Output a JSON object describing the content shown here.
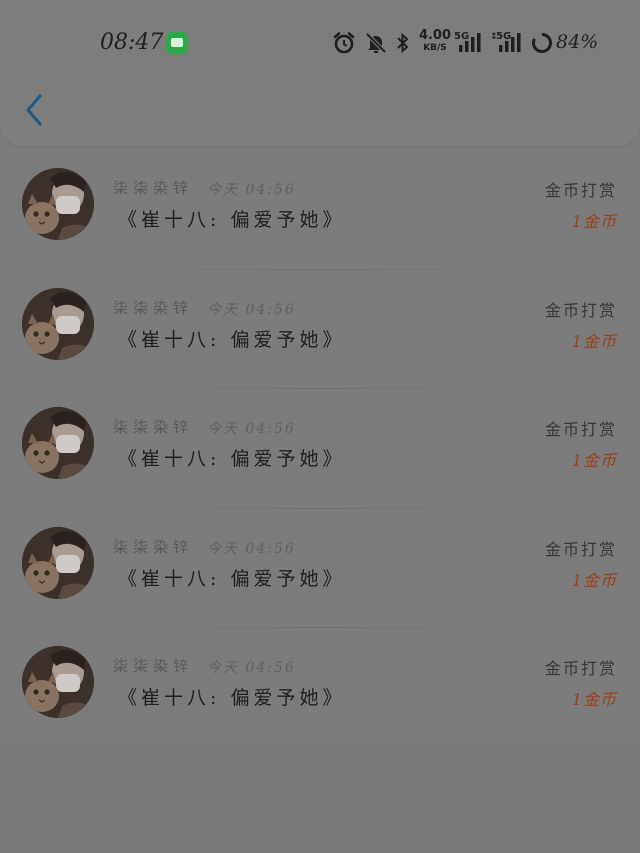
{
  "status_bar": {
    "time": "08:47",
    "net_speed_value": "4.00",
    "net_speed_unit": "KB/S",
    "signal_1": "5G",
    "signal_2": "5G",
    "battery": "84%",
    "icons": [
      "message-app-icon",
      "alarm-icon",
      "mute-bell-icon",
      "bluetooth-icon",
      "signal-icon",
      "battery-ring-icon"
    ]
  },
  "header": {
    "back_icon": "chevron-left-icon"
  },
  "rewards": [
    {
      "sender": "柒柒染锌",
      "time": "今天 04:56",
      "content": "《崔十八: 偏爱予她》",
      "label": "金币打赏",
      "amount": "1金币"
    },
    {
      "sender": "柒柒染锌",
      "time": "今天 04:56",
      "content": "《崔十八: 偏爱予她》",
      "label": "金币打赏",
      "amount": "1金币"
    },
    {
      "sender": "柒柒染锌",
      "time": "今天 04:56",
      "content": "《崔十八: 偏爱予她》",
      "label": "金币打赏",
      "amount": "1金币"
    },
    {
      "sender": "柒柒染锌",
      "time": "今天 04:56",
      "content": "《崔十八: 偏爱予她》",
      "label": "金币打赏",
      "amount": "1金币"
    },
    {
      "sender": "柒柒染锌",
      "time": "今天 04:56",
      "content": "《崔十八: 偏爱予她》",
      "label": "金币打赏",
      "amount": "1金币"
    }
  ],
  "colors": {
    "accent": "#1f5a86",
    "amount": "#9c3f17",
    "overlay_bg": "#7c7c7c"
  }
}
